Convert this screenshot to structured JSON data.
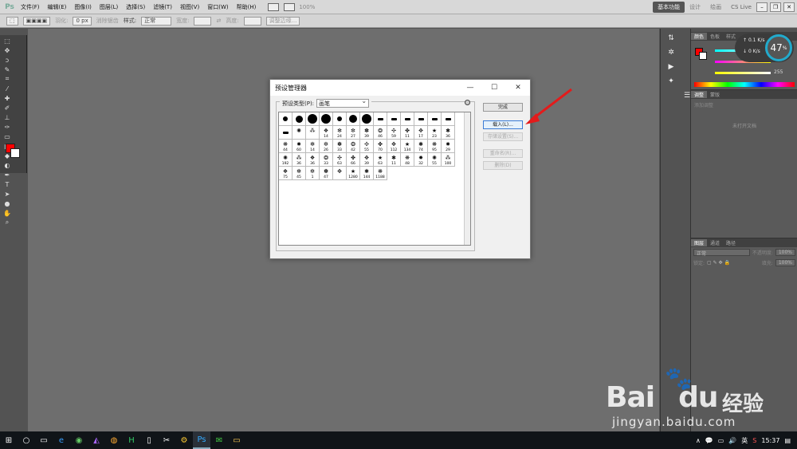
{
  "menubar": {
    "logo": "Ps",
    "items": [
      "文件(F)",
      "编辑(E)",
      "图像(I)",
      "图层(L)",
      "选择(S)",
      "滤镜(T)",
      "视图(V)",
      "窗口(W)",
      "帮助(H)"
    ],
    "zoom": "100%",
    "workspace": "基本功能",
    "workspace_options": [
      "设计",
      "绘画"
    ],
    "cs_live": "CS Live"
  },
  "options": {
    "feather_label": "羽化:",
    "feather_value": "0 px",
    "antialias": "消除锯齿",
    "style_label": "样式:",
    "style_value": "正常",
    "width_label": "宽度:",
    "height_label": "高度:",
    "refine_btn": "调整边缘..."
  },
  "colorpanel": {
    "tabs": [
      "颜色",
      "色板",
      "样式"
    ],
    "r_val": "",
    "g_val": "",
    "b_val": "255"
  },
  "adjustpanel": {
    "tabs": [
      "调整",
      "蒙版"
    ],
    "subtitle": "添加调整",
    "empty": "未打开文档"
  },
  "layerspanel": {
    "tabs": [
      "图层",
      "通道",
      "路径"
    ],
    "blend": "正常",
    "opacity_label": "不透明度:",
    "opacity": "100%",
    "lock_label": "锁定:",
    "fill_label": "填充:",
    "fill": "100%"
  },
  "perf": {
    "upload": "0.1",
    "download": "0",
    "unit": "K/s",
    "percent": "47",
    "percent_unit": "%"
  },
  "dialog": {
    "title": "预设管理器",
    "preset_label": "预设类型(P):",
    "preset_value": "画笔",
    "buttons": {
      "done": "完成",
      "load": "载入(L)...",
      "save": "存储设置(S)...",
      "rename": "重命名(R)...",
      "delete": "删除(D)"
    },
    "brush_rows": [
      [
        "",
        "",
        "",
        "",
        "",
        "",
        "",
        "",
        "",
        "",
        "",
        "",
        "",
        ""
      ],
      [
        "",
        "",
        "14",
        "24",
        "27",
        "39",
        "46",
        "59",
        "11",
        "17",
        "23",
        "36",
        "44",
        "60"
      ],
      [
        "14",
        "26",
        "33",
        "42",
        "55",
        "70",
        "112",
        "134",
        "74",
        "95",
        "29",
        "192",
        "36",
        "36"
      ],
      [
        "33",
        "63",
        "66",
        "39",
        "63",
        "11",
        "48",
        "32",
        "55",
        "100",
        "75",
        "45",
        "1",
        "47"
      ],
      [
        "",
        "1280",
        "144",
        "1188"
      ]
    ]
  },
  "taskbar": {
    "lang": "英",
    "time": "15:37"
  },
  "watermark": {
    "brand": "Bai",
    "brand2": "du",
    "cn": "经验",
    "url": "jingyan.baidu.com"
  }
}
